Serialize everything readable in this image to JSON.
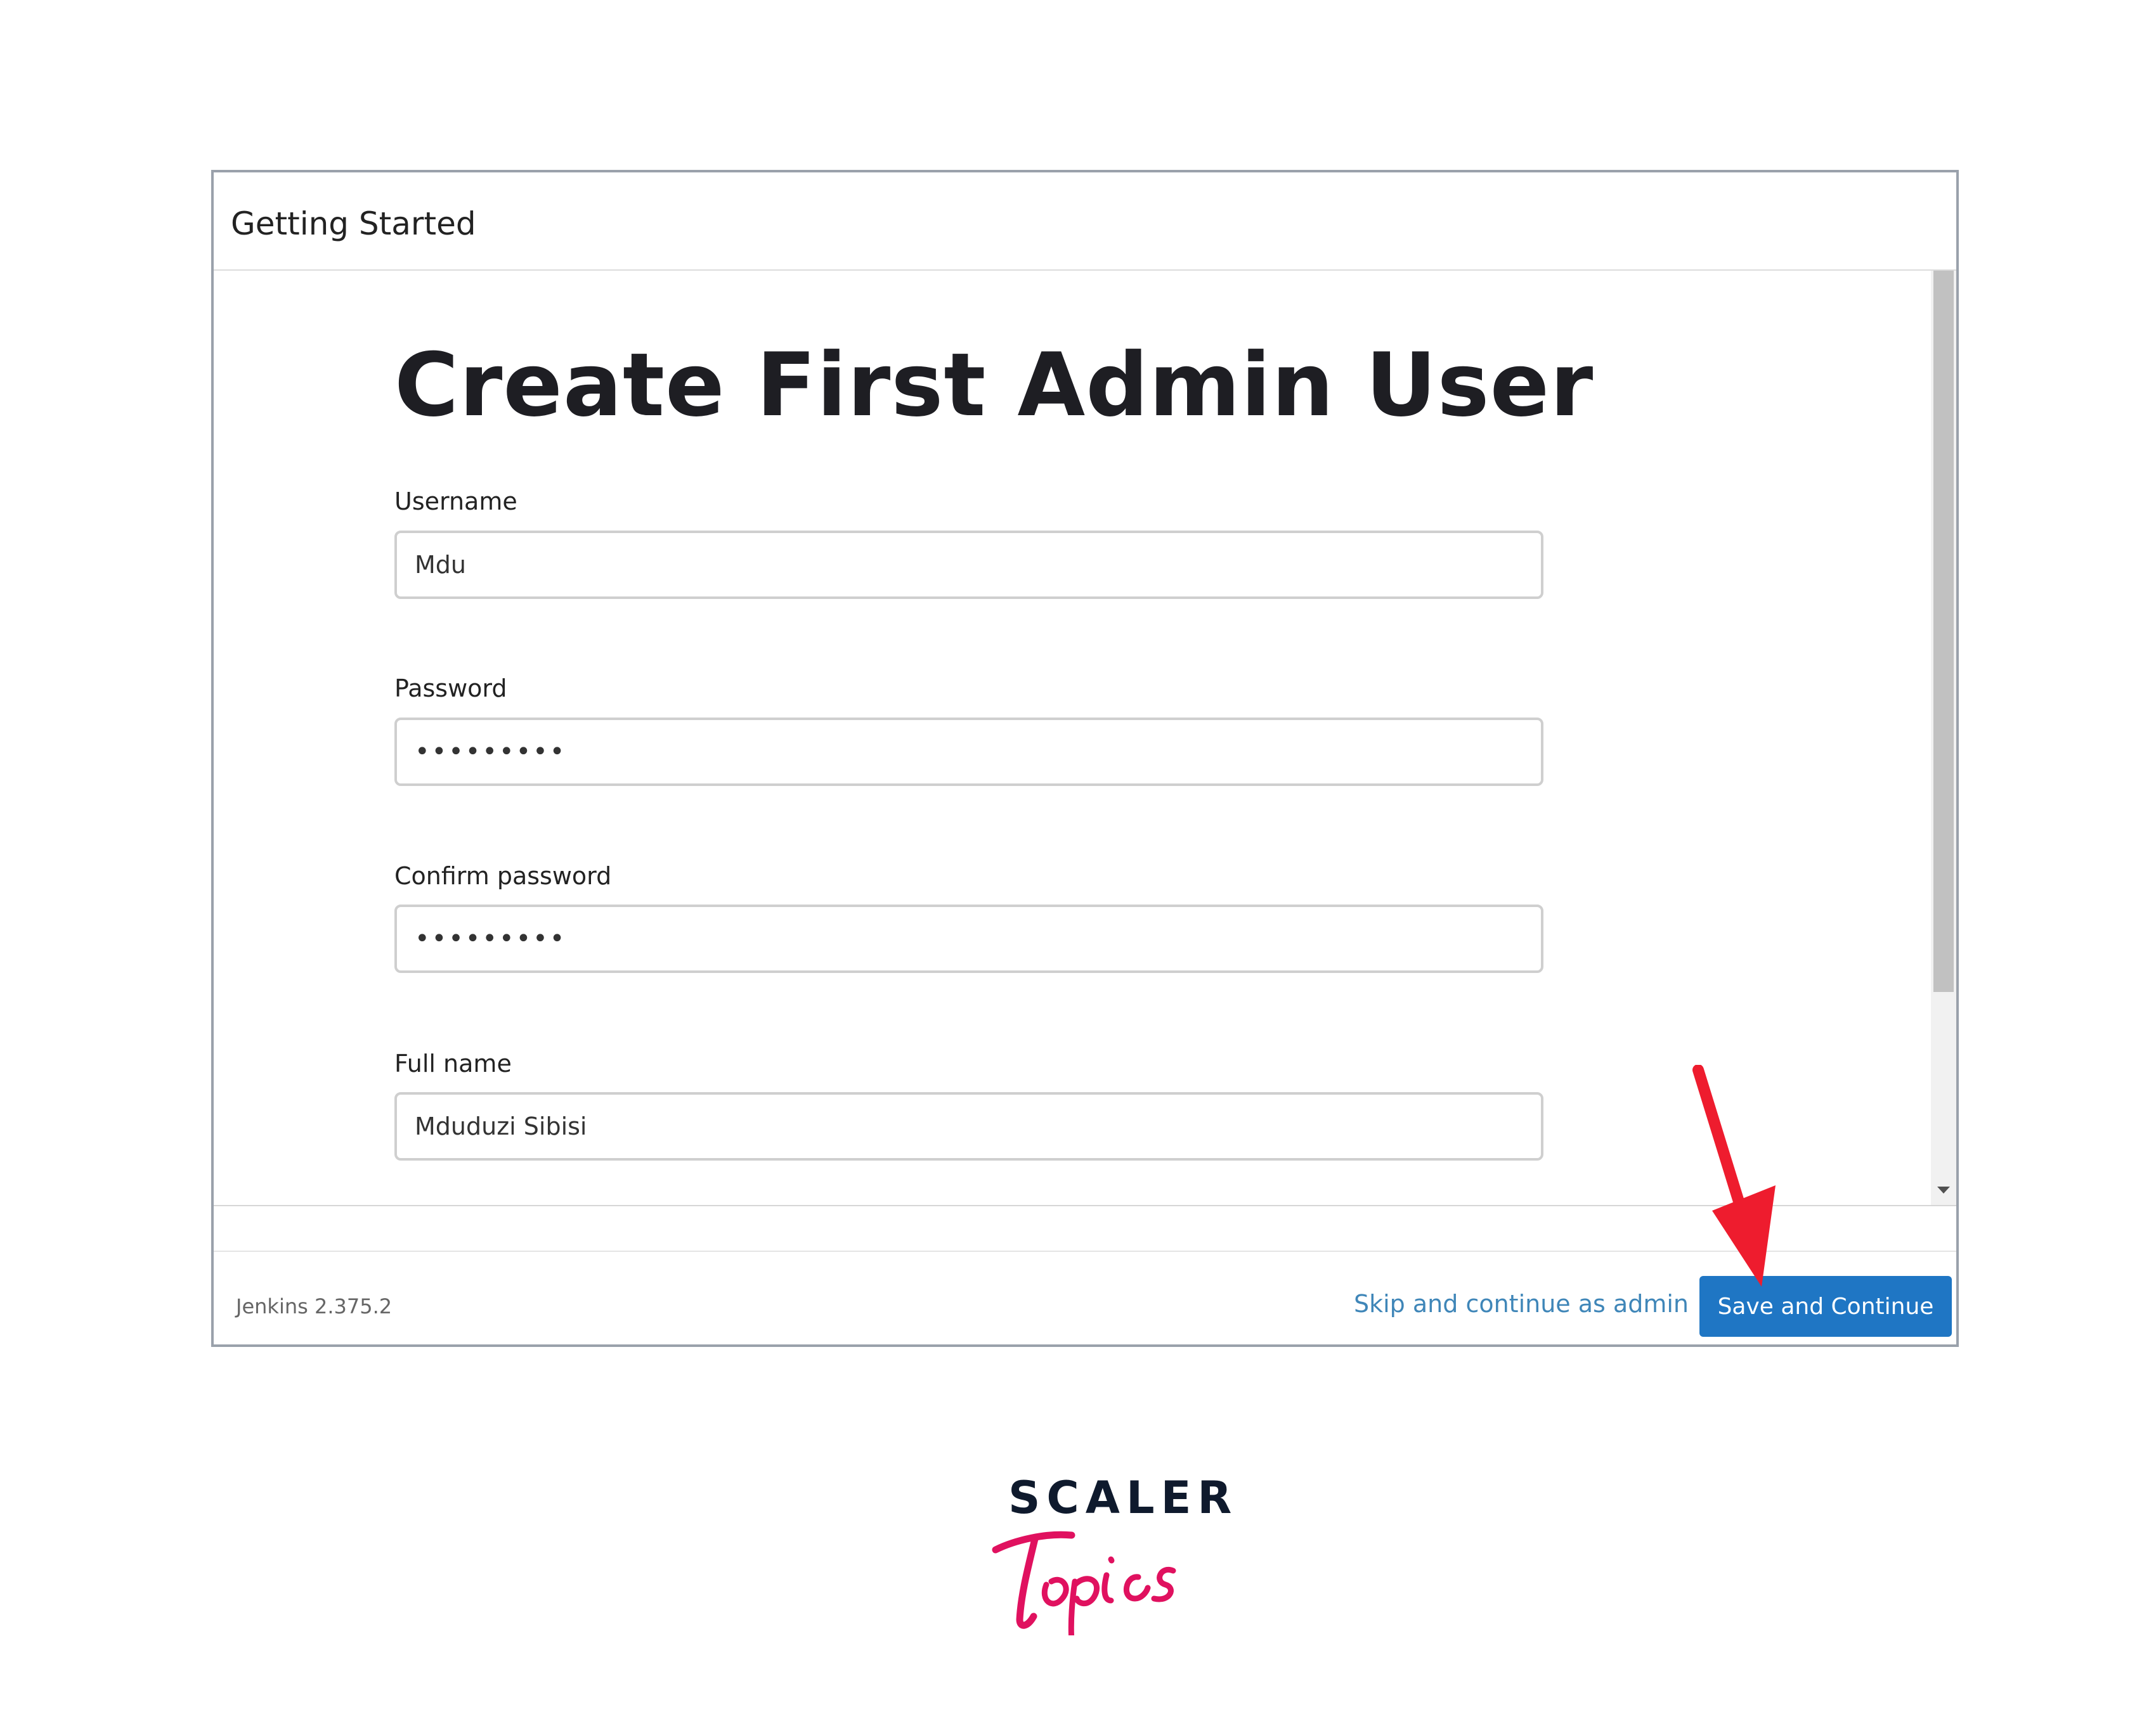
{
  "dialog": {
    "title": "Getting Started"
  },
  "form": {
    "heading": "Create First Admin User",
    "fields": [
      {
        "label": "Username",
        "value": "Mdu",
        "type": "text"
      },
      {
        "label": "Password",
        "value": "•••••••••",
        "type": "password"
      },
      {
        "label": "Confirm password",
        "value": "•••••••••",
        "type": "password"
      },
      {
        "label": "Full name",
        "value": "Mduduzi Sibisi",
        "type": "text"
      }
    ]
  },
  "footer": {
    "version": "Jenkins 2.375.2",
    "skip_label": "Skip and continue as admin",
    "save_label": "Save and Continue"
  },
  "annotation": {
    "arrow_color": "#ee1c2e"
  },
  "branding": {
    "top": "SCALER",
    "bottom": "Topics",
    "top_color": "#0f1a2d",
    "bottom_color": "#e0115f"
  },
  "colors": {
    "primary_button": "#1f76c4",
    "link": "#3f86b8"
  }
}
